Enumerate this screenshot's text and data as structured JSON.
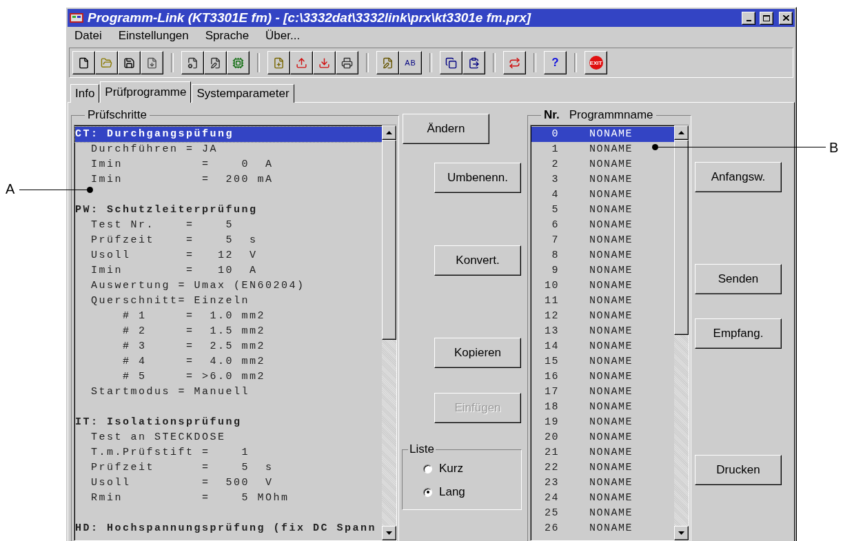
{
  "window": {
    "title": "Programm-Link (KT3301E fm) - [c:\\3332dat\\3332link\\prx\\kt3301e fm.prx]"
  },
  "menu": [
    "Datei",
    "Einstellungen",
    "Sprache",
    "Über..."
  ],
  "toolbar": {
    "rename_label": "AB",
    "help_label": "?",
    "exit_label": "EXIT"
  },
  "tabs": [
    {
      "label": "Info",
      "selected": false
    },
    {
      "label": "Prüfprogramme",
      "selected": true
    },
    {
      "label": "Systemparameter",
      "selected": false
    }
  ],
  "steps": {
    "title": "Prüfschritte",
    "lines": [
      {
        "kind": "header",
        "text": "CT: Durchgangspüfung",
        "selected": true
      },
      {
        "kind": "item",
        "text": "  Durchführen = JA",
        "selected": false
      },
      {
        "kind": "item",
        "text": "  Imin          =    0  A",
        "selected": false
      },
      {
        "kind": "item",
        "text": "  Imin          =  200 mA",
        "selected": false
      },
      {
        "kind": "blank",
        "selected": false
      },
      {
        "kind": "header",
        "text": "PW: Schutzleiterprüfung",
        "selected": false
      },
      {
        "kind": "item",
        "text": "  Test Nr.    =    5",
        "selected": false
      },
      {
        "kind": "item",
        "text": "  Prüfzeit    =    5  s",
        "selected": false
      },
      {
        "kind": "item",
        "text": "  Usoll       =   12  V",
        "selected": false
      },
      {
        "kind": "item",
        "text": "  Imin        =   10  A",
        "selected": false
      },
      {
        "kind": "item",
        "text": "  Auswertung = Umax (EN60204)",
        "selected": false
      },
      {
        "kind": "item",
        "text": "  Querschnitt= Einzeln",
        "selected": false
      },
      {
        "kind": "item",
        "text": "      # 1     =  1.0 mm2",
        "selected": false
      },
      {
        "kind": "item",
        "text": "      # 2     =  1.5 mm2",
        "selected": false
      },
      {
        "kind": "item",
        "text": "      # 3     =  2.5 mm2",
        "selected": false
      },
      {
        "kind": "item",
        "text": "      # 4     =  4.0 mm2",
        "selected": false
      },
      {
        "kind": "item",
        "text": "      # 5     = >6.0 mm2",
        "selected": false
      },
      {
        "kind": "item",
        "text": "  Startmodus = Manuell",
        "selected": false
      },
      {
        "kind": "blank",
        "selected": false
      },
      {
        "kind": "header",
        "text": "IT: Isolationsprüfung",
        "selected": false
      },
      {
        "kind": "item",
        "text": "  Test an STECKDOSE",
        "selected": false
      },
      {
        "kind": "item",
        "text": "  T.m.Prüfstift =    1",
        "selected": false
      },
      {
        "kind": "item",
        "text": "  Prüfzeit      =    5  s",
        "selected": false
      },
      {
        "kind": "item",
        "text": "  Usoll         =  500  V",
        "selected": false
      },
      {
        "kind": "item",
        "text": "  Rmin          =    5 MOhm",
        "selected": false
      },
      {
        "kind": "blank",
        "selected": false
      },
      {
        "kind": "header",
        "text": "HD: Hochspannungsprüfung (fix DC Spann",
        "selected": false
      }
    ]
  },
  "middle_buttons": [
    {
      "label": "Ändern",
      "disabled": false
    },
    {
      "label": "Umbenenn.",
      "disabled": false
    },
    {
      "label": "Konvert.",
      "disabled": false
    },
    {
      "label": "Kopieren",
      "disabled": false
    },
    {
      "label": "Einfügen",
      "disabled": true
    }
  ],
  "liste": {
    "title": "Liste",
    "options": [
      {
        "label": "Kurz",
        "selected": false
      },
      {
        "label": "Lang",
        "selected": true
      }
    ]
  },
  "programs": {
    "columns": [
      "Nr.",
      "Programmname"
    ],
    "rows": [
      {
        "nr": "0",
        "name": "NONAME",
        "selected": true
      },
      {
        "nr": "1",
        "name": "NONAME",
        "selected": false
      },
      {
        "nr": "2",
        "name": "NONAME",
        "selected": false
      },
      {
        "nr": "3",
        "name": "NONAME",
        "selected": false
      },
      {
        "nr": "4",
        "name": "NONAME",
        "selected": false
      },
      {
        "nr": "5",
        "name": "NONAME",
        "selected": false
      },
      {
        "nr": "6",
        "name": "NONAME",
        "selected": false
      },
      {
        "nr": "7",
        "name": "NONAME",
        "selected": false
      },
      {
        "nr": "8",
        "name": "NONAME",
        "selected": false
      },
      {
        "nr": "9",
        "name": "NONAME",
        "selected": false
      },
      {
        "nr": "10",
        "name": "NONAME",
        "selected": false
      },
      {
        "nr": "11",
        "name": "NONAME",
        "selected": false
      },
      {
        "nr": "12",
        "name": "NONAME",
        "selected": false
      },
      {
        "nr": "13",
        "name": "NONAME",
        "selected": false
      },
      {
        "nr": "14",
        "name": "NONAME",
        "selected": false
      },
      {
        "nr": "15",
        "name": "NONAME",
        "selected": false
      },
      {
        "nr": "16",
        "name": "NONAME",
        "selected": false
      },
      {
        "nr": "17",
        "name": "NONAME",
        "selected": false
      },
      {
        "nr": "18",
        "name": "NONAME",
        "selected": false
      },
      {
        "nr": "19",
        "name": "NONAME",
        "selected": false
      },
      {
        "nr": "20",
        "name": "NONAME",
        "selected": false
      },
      {
        "nr": "21",
        "name": "NONAME",
        "selected": false
      },
      {
        "nr": "22",
        "name": "NONAME",
        "selected": false
      },
      {
        "nr": "23",
        "name": "NONAME",
        "selected": false
      },
      {
        "nr": "24",
        "name": "NONAME",
        "selected": false
      },
      {
        "nr": "25",
        "name": "NONAME",
        "selected": false
      },
      {
        "nr": "26",
        "name": "NONAME",
        "selected": false
      }
    ]
  },
  "right_buttons": [
    {
      "label": "Anfangsw.",
      "disabled": false
    },
    {
      "label": "Senden",
      "disabled": false
    },
    {
      "label": "Empfang.",
      "disabled": false
    },
    {
      "label": "Drucken",
      "disabled": false
    }
  ],
  "callouts": [
    {
      "label": "A"
    },
    {
      "label": "B"
    }
  ]
}
